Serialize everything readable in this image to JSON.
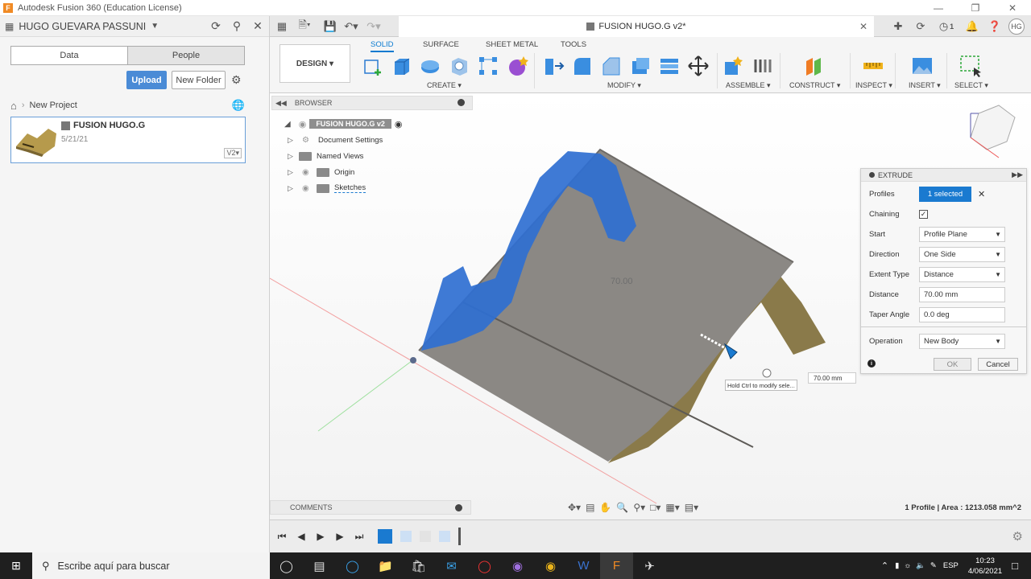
{
  "window": {
    "title": "Autodesk Fusion 360 (Education License)",
    "logo": "F"
  },
  "datapanel": {
    "user": "HUGO GUEVARA PASSUNI",
    "tabs": [
      "Data",
      "People"
    ],
    "upload": "Upload",
    "new_folder": "New Folder",
    "project": "New Project",
    "file": {
      "name": "FUSION HUGO.G",
      "date": "5/21/21",
      "version": "V2▾"
    }
  },
  "tabbar": {
    "doc_title": "FUSION HUGO.G v2*",
    "notif_count": "1",
    "avatar": "HG"
  },
  "toolbar": {
    "design": "DESIGN ▾",
    "tabs": [
      "SOLID",
      "SURFACE",
      "SHEET METAL",
      "TOOLS"
    ],
    "groups": [
      "CREATE ▾",
      "MODIFY ▾",
      "ASSEMBLE ▾",
      "CONSTRUCT ▾",
      "INSPECT ▾",
      "INSERT ▾",
      "SELECT ▾"
    ]
  },
  "browser": {
    "title": "BROWSER",
    "root": "FUSION HUGO.G v2",
    "items": [
      "Document Settings",
      "Named Views",
      "Origin",
      "Sketches"
    ]
  },
  "comments": "COMMENTS",
  "viewport": {
    "dim_label": "70.00",
    "hint": "Hold Ctrl to modify sele...",
    "input_value": "70.00 mm",
    "status": "1 Profile | Area : 1213.058 mm^2"
  },
  "extrude": {
    "title": "EXTRUDE",
    "rows": {
      "profiles_label": "Profiles",
      "profiles_value": "1 selected",
      "chaining_label": "Chaining",
      "start_label": "Start",
      "start_value": "Profile Plane",
      "direction_label": "Direction",
      "direction_value": "One Side",
      "extent_label": "Extent Type",
      "extent_value": "Distance",
      "distance_label": "Distance",
      "distance_value": "70.00 mm",
      "taper_label": "Taper Angle",
      "taper_value": "0.0 deg",
      "operation_label": "Operation",
      "operation_value": "New Body"
    },
    "ok": "OK",
    "cancel": "Cancel"
  },
  "taskbar": {
    "search_placeholder": "Escribe aquí para buscar",
    "lang": "ESP",
    "time": "10:23",
    "date": "4/06/2021"
  },
  "colors": {
    "accent": "#1a7ad0",
    "selection_blue": "#2f6fd1",
    "body_gray": "#8b8884",
    "body_gold": "#8a7a4a"
  }
}
